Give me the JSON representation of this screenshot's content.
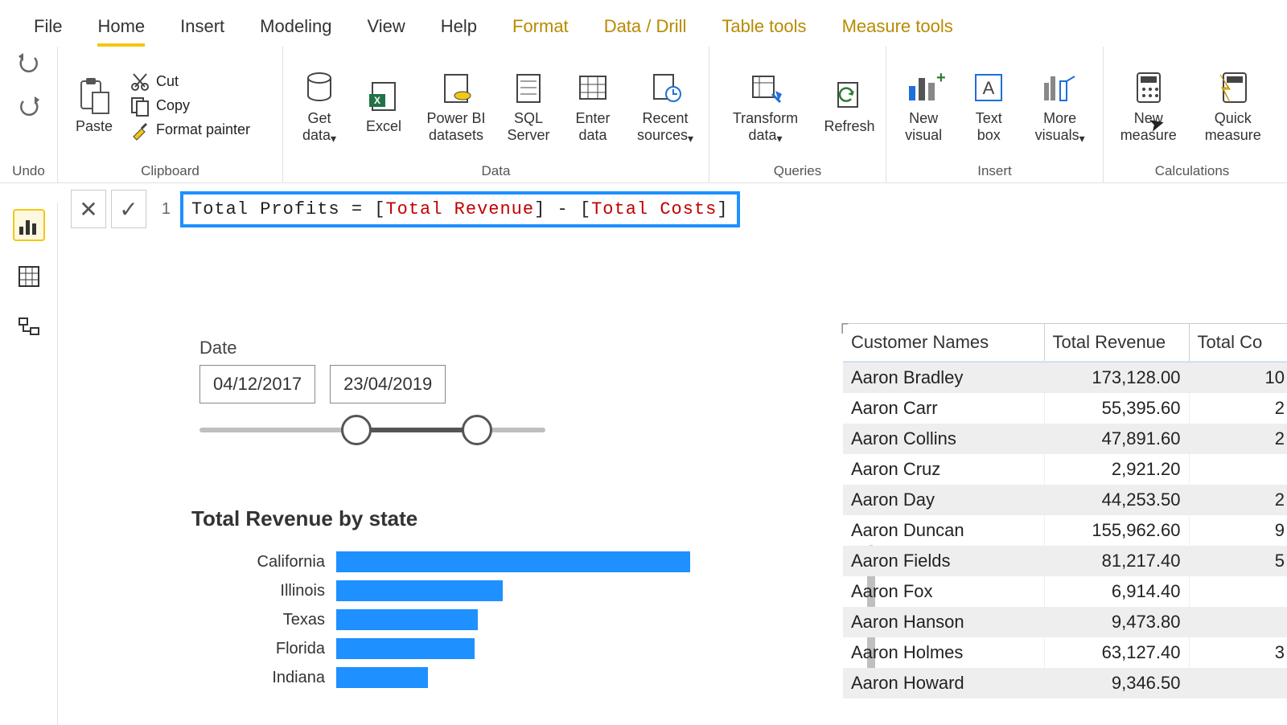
{
  "menu": {
    "file": "File",
    "home": "Home",
    "insert": "Insert",
    "modeling": "Modeling",
    "view": "View",
    "help": "Help",
    "format": "Format",
    "datadrill": "Data / Drill",
    "tabletools": "Table tools",
    "measuretools": "Measure tools"
  },
  "ribbon": {
    "undo": "Undo",
    "paste": "Paste",
    "cut": "Cut",
    "copy": "Copy",
    "formatpainter": "Format painter",
    "clipboard": "Clipboard",
    "getdata": "Get data",
    "excel": "Excel",
    "pbids": "Power BI datasets",
    "sql": "SQL Server",
    "enter": "Enter data",
    "recent": "Recent sources",
    "data": "Data",
    "transform": "Transform data",
    "refresh": "Refresh",
    "queries": "Queries",
    "newvisual": "New visual",
    "textbox": "Text box",
    "morevisuals": "More visuals",
    "insert": "Insert",
    "newmeasure": "New measure",
    "quickmeasure": "Quick measure",
    "calculations": "Calculations"
  },
  "formula": {
    "line": "1",
    "name": "Total Profits",
    "eq": " = ",
    "lb1": "[",
    "ref1": "Total Revenue",
    "rb1": "]",
    "minus": " - ",
    "lb2": "[",
    "ref2": "Total Costs",
    "rb2": "]"
  },
  "slicer": {
    "title": "Date",
    "start": "04/12/2017",
    "end": "23/04/2019"
  },
  "chart_data": {
    "type": "bar",
    "title": "Total Revenue by state",
    "categories": [
      "California",
      "Illinois",
      "Texas",
      "Florida",
      "Indiana"
    ],
    "values": [
      100,
      47,
      40,
      39,
      26
    ],
    "xlabel": "",
    "ylabel": "",
    "ylim": [
      0,
      100
    ]
  },
  "table": {
    "cols": [
      "Customer Names",
      "Total Revenue",
      "Total Co"
    ],
    "rows": [
      {
        "name": "Aaron Bradley",
        "rev": "173,128.00",
        "cost": "10"
      },
      {
        "name": "Aaron Carr",
        "rev": "55,395.60",
        "cost": "2"
      },
      {
        "name": "Aaron Collins",
        "rev": "47,891.60",
        "cost": "2"
      },
      {
        "name": "Aaron Cruz",
        "rev": "2,921.20",
        "cost": ""
      },
      {
        "name": "Aaron Day",
        "rev": "44,253.50",
        "cost": "2"
      },
      {
        "name": "Aaron Duncan",
        "rev": "155,962.60",
        "cost": "9"
      },
      {
        "name": "Aaron Fields",
        "rev": "81,217.40",
        "cost": "5"
      },
      {
        "name": "Aaron Fox",
        "rev": "6,914.40",
        "cost": ""
      },
      {
        "name": "Aaron Hanson",
        "rev": "9,473.80",
        "cost": ""
      },
      {
        "name": "Aaron Holmes",
        "rev": "63,127.40",
        "cost": "3"
      },
      {
        "name": "Aaron Howard",
        "rev": "9,346.50",
        "cost": ""
      }
    ]
  }
}
